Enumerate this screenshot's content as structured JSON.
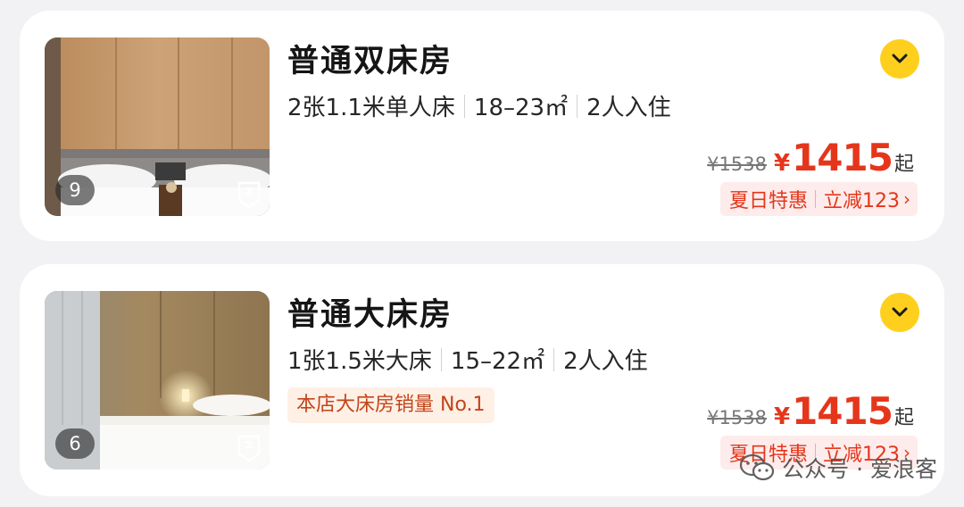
{
  "rooms": [
    {
      "name": "普通双床房",
      "photo_count": "9",
      "specs": [
        "2张1.1米单人床",
        "18–23㎡",
        "2人入住"
      ],
      "tag": "",
      "original_price": "¥1538",
      "currency": "¥",
      "price": "1415",
      "price_suffix": "起",
      "promo_name": "夏日特惠",
      "promo_discount": "立减123",
      "promo_chevron": "›"
    },
    {
      "name": "普通大床房",
      "photo_count": "6",
      "specs": [
        "1张1.5米大床",
        "15–22㎡",
        "2人入住"
      ],
      "tag": "本店大床房销量 No.1",
      "original_price": "¥1538",
      "currency": "¥",
      "price": "1415",
      "price_suffix": "起",
      "promo_name": "夏日特惠",
      "promo_discount": "立减123",
      "promo_chevron": "›"
    }
  ],
  "watermark": "公众号 · 爱浪客",
  "icons": {
    "expand": "chevron-down-icon",
    "vr": "vr-tour-icon",
    "watermark": "wechat-icon"
  },
  "colors": {
    "accent_yellow": "#ffcf1e",
    "price_red": "#e5361b",
    "tag_orange": "#c2451a",
    "tag_bg": "#fff0e6",
    "promo_bg": "#fdeceb"
  }
}
